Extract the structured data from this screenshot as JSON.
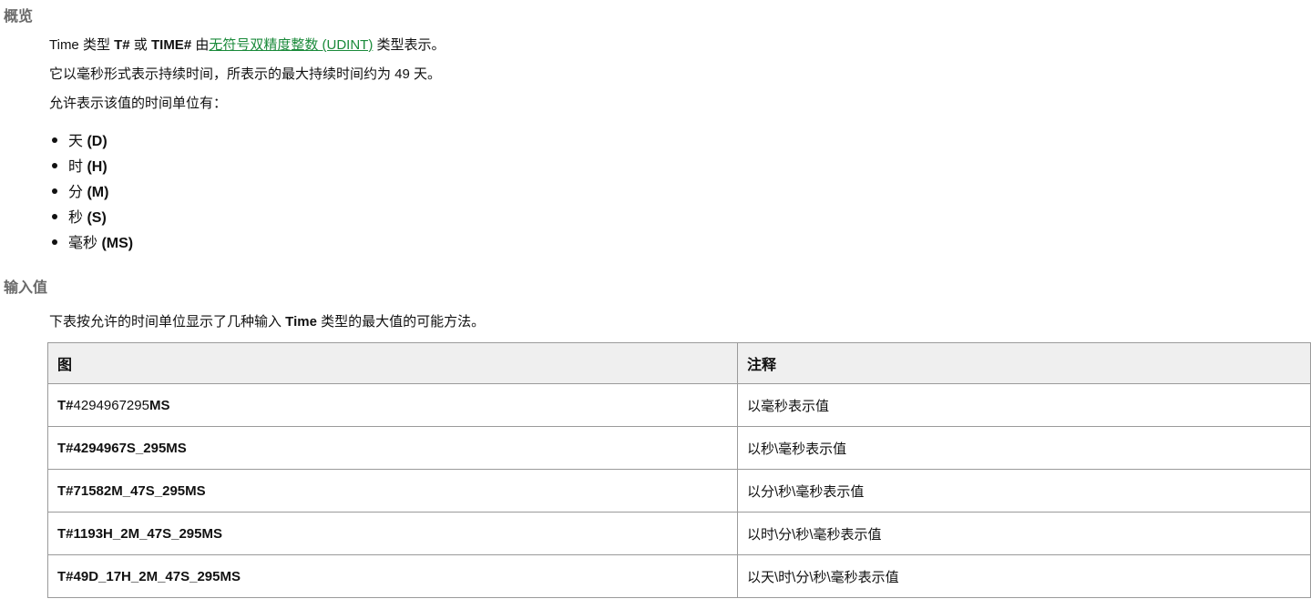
{
  "headings": {
    "overview": "概览",
    "input": "输入值"
  },
  "overview": {
    "p1_prefix": "Time 类型 ",
    "p1_t": "T#",
    "p1_or": " 或 ",
    "p1_time": "TIME#",
    "p1_by": " 由",
    "p1_link": "无符号双精度整数 (UDINT)",
    "p1_suffix": " 类型表示。",
    "p2": "它以毫秒形式表示持续时间，所表示的最大持续时间约为 49 天。",
    "p3": "允许表示该值的时间单位有："
  },
  "units": [
    {
      "name": "天",
      "abbr": "(D)"
    },
    {
      "name": "时",
      "abbr": "(H)"
    },
    {
      "name": "分",
      "abbr": "(M)"
    },
    {
      "name": "秒",
      "abbr": "(S)"
    },
    {
      "name": "毫秒",
      "abbr": "(MS)"
    }
  ],
  "input": {
    "intro_prefix": "下表按允许的时间单位显示了几种输入 ",
    "intro_bold": "Time",
    "intro_suffix": " 类型的最大值的可能方法。"
  },
  "table": {
    "headers": [
      "图",
      "注释"
    ],
    "rows": [
      {
        "pre": "T#",
        "mid": "4294967295",
        "post": "MS",
        "note": "以毫秒表示值"
      },
      {
        "pre": "T#",
        "mid": "4294967S_295",
        "post": "MS",
        "note": "以秒\\毫秒表示值"
      },
      {
        "pre": "T#",
        "mid": "71582M_47S_295",
        "post": "MS",
        "note": "以分\\秒\\毫秒表示值"
      },
      {
        "pre": "T#",
        "mid": "1193H_2M_47S_295",
        "post": "MS",
        "note": "以时\\分\\秒\\毫秒表示值"
      },
      {
        "pre": "T#",
        "mid": "49D_17H_2M_47S_295",
        "post": "MS",
        "note": "以天\\时\\分\\秒\\毫秒表示值"
      }
    ]
  }
}
